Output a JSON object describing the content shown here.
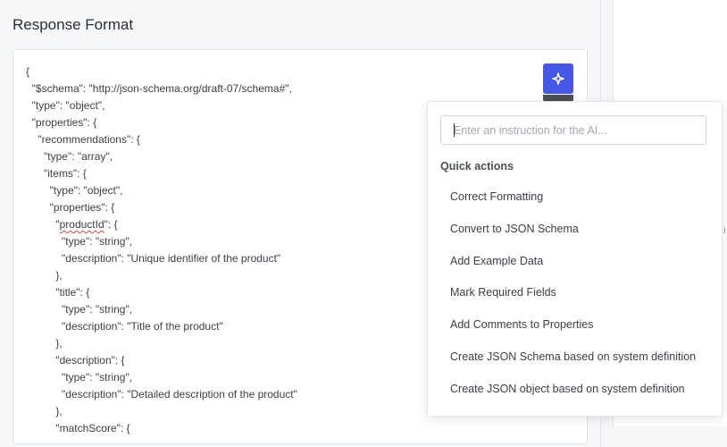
{
  "section": {
    "title": "Response Format"
  },
  "editor": {
    "lines": [
      "{",
      "  \"$schema\": \"http://json-schema.org/draft-07/schema#\",",
      "  \"type\": \"object\",",
      "  \"properties\": {",
      "    \"recommendations\": {",
      "      \"type\": \"array\",",
      "      \"items\": {",
      "        \"type\": \"object\",",
      "        \"properties\": {",
      "          \"productId\": {",
      "            \"type\": \"string\",",
      "            \"description\": \"Unique identifier of the product\"",
      "          },",
      "          \"title\": {",
      "            \"type\": \"string\",",
      "            \"description\": \"Title of the product\"",
      "          },",
      "          \"description\": {",
      "            \"type\": \"string\",",
      "            \"description\": \"Detailed description of the product\"",
      "          },",
      "          \"matchScore\": {"
    ],
    "misspelled_word": "productId"
  },
  "ai_button": {
    "icon": "sparkle-icon",
    "color": "#4757e6"
  },
  "ai_popover": {
    "input_placeholder": "Enter an instruction for the AI...",
    "input_value": "",
    "quick_actions_label": "Quick actions",
    "actions": [
      {
        "label": "Correct Formatting"
      },
      {
        "label": "Convert to JSON Schema"
      },
      {
        "label": "Add Example Data"
      },
      {
        "label": "Mark Required Fields"
      },
      {
        "label": "Add Comments to Properties"
      },
      {
        "label": "Create JSON Schema based on system definition"
      },
      {
        "label": "Create JSON object based on system definition"
      }
    ]
  },
  "right_panel": {
    "edge_glyph": "i"
  }
}
